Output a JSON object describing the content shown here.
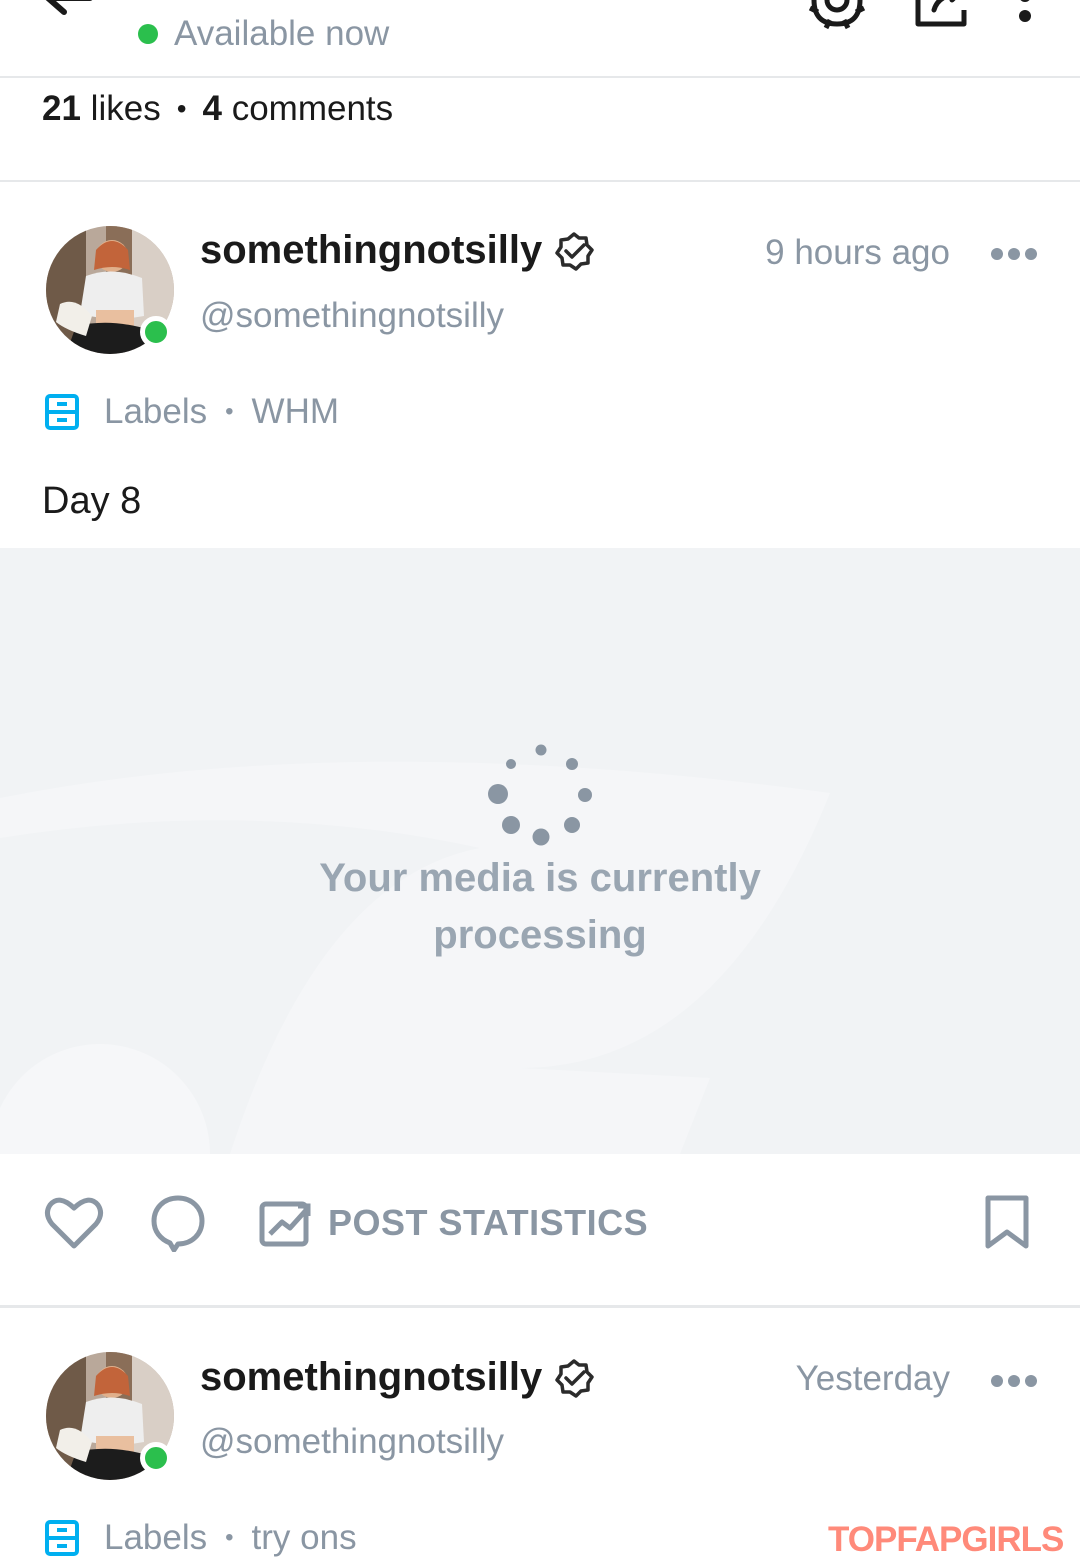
{
  "header": {
    "status_text": "Available now",
    "status_color": "#2bbf4d"
  },
  "summary": {
    "likes_count": "21",
    "likes_label": "likes",
    "comments_count": "4",
    "comments_label": "comments"
  },
  "posts": [
    {
      "display_name": "somethingnotsilly",
      "handle": "@somethingnotsilly",
      "timestamp": "9 hours ago",
      "labels_title": "Labels",
      "label_value": "WHM",
      "text": "Day 8",
      "media_status": "Your media is currently processing",
      "actions": {
        "statistics_label": "POST STATISTICS"
      }
    },
    {
      "display_name": "somethingnotsilly",
      "handle": "@somethingnotsilly",
      "timestamp": "Yesterday",
      "labels_title": "Labels",
      "label_value": "try ons"
    }
  ],
  "watermark": "TOPFAPGIRLS",
  "icons": {
    "back": "arrow-left-icon",
    "settings": "gear-icon",
    "share": "share-icon",
    "menu": "kebab-menu-icon",
    "verified": "verified-badge-icon",
    "more": "more-horizontal-icon",
    "labels": "label-folder-icon",
    "like": "heart-icon",
    "comment": "comment-icon",
    "statistics": "chart-icon",
    "bookmark": "bookmark-icon",
    "spinner": "loading-spinner-icon"
  },
  "colors": {
    "accent": "#00aff0",
    "muted_text": "#8a96a3",
    "online": "#2bbf4d",
    "media_bg": "#f1f3f5"
  }
}
